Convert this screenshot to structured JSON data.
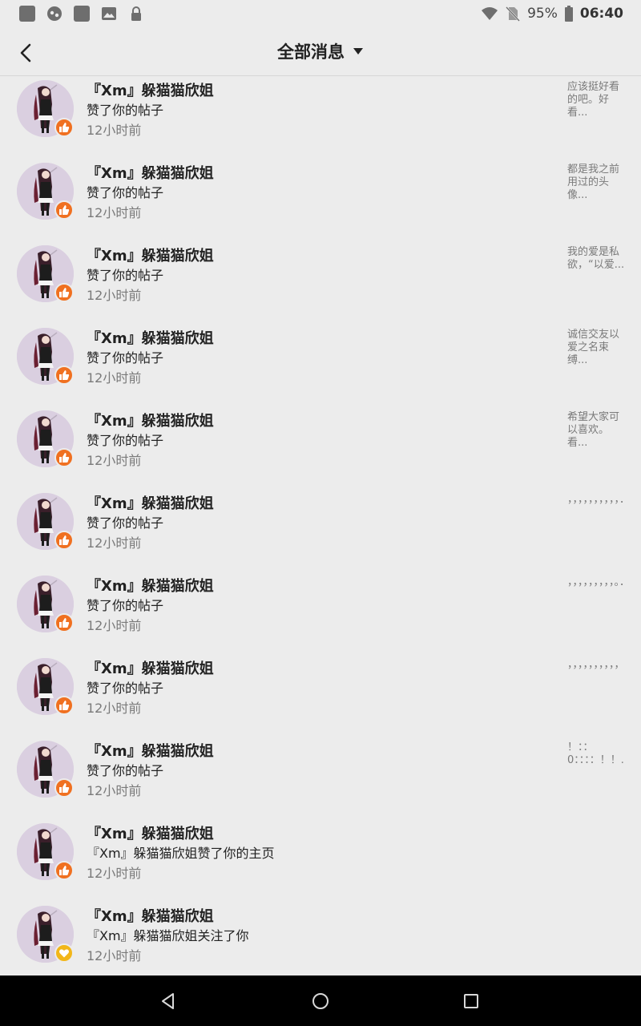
{
  "status_bar": {
    "battery": "95%",
    "time": "06:40",
    "icons": [
      "notification-square-icon",
      "app-icon",
      "notification-square-icon",
      "image-icon",
      "lock-icon",
      "wifi-icon",
      "no-sim-icon",
      "battery-icon"
    ]
  },
  "header": {
    "title": "全部消息",
    "back_icon": "back-chevron-icon",
    "dropdown_icon": "dropdown-triangle-icon"
  },
  "messages": [
    {
      "name": "『Xm』躲猫猫欣姐",
      "action": "赞了你的帖子",
      "time": "12小时前",
      "preview": "应该挺好看的吧。好看...",
      "badge": "like"
    },
    {
      "name": "『Xm』躲猫猫欣姐",
      "action": "赞了你的帖子",
      "time": "12小时前",
      "preview": "都是我之前用过的头像...",
      "badge": "like"
    },
    {
      "name": "『Xm』躲猫猫欣姐",
      "action": "赞了你的帖子",
      "time": "12小时前",
      "preview": "我的爱是私欲，“以爱...",
      "badge": "like"
    },
    {
      "name": "『Xm』躲猫猫欣姐",
      "action": "赞了你的帖子",
      "time": "12小时前",
      "preview": "诚信交友以爱之名束缚...",
      "badge": "like"
    },
    {
      "name": "『Xm』躲猫猫欣姐",
      "action": "赞了你的帖子",
      "time": "12小时前",
      "preview": "希望大家可以喜欢。看...",
      "badge": "like"
    },
    {
      "name": "『Xm』躲猫猫欣姐",
      "action": "赞了你的帖子",
      "time": "12小时前",
      "preview": "，，，，，，，，，，．..",
      "badge": "like"
    },
    {
      "name": "『Xm』躲猫猫欣姐",
      "action": "赞了你的帖子",
      "time": "12小时前",
      "preview": "，，，，，，，，，。．..",
      "badge": "like"
    },
    {
      "name": "『Xm』躲猫猫欣姐",
      "action": "赞了你的帖子",
      "time": "12小时前",
      "preview": "，，，，，，，，，，",
      "badge": "like"
    },
    {
      "name": "『Xm』躲猫猫欣姐",
      "action": "赞了你的帖子",
      "time": "12小时前",
      "preview": "！：：0：：：：！！...",
      "badge": "like"
    },
    {
      "name": "『Xm』躲猫猫欣姐",
      "action": "『Xm』躲猫猫欣姐赞了你的主页",
      "time": "12小时前",
      "preview": "",
      "badge": "like"
    },
    {
      "name": "『Xm』躲猫猫欣姐",
      "action": "『Xm』躲猫猫欣姐关注了你",
      "time": "12小时前",
      "preview": "",
      "badge": "follow"
    }
  ],
  "badge_colors": {
    "like": "#f07020",
    "follow": "#f2b619"
  },
  "nav_bar": {
    "icons": [
      "back-triangle-icon",
      "home-circle-icon",
      "recents-square-icon"
    ]
  }
}
